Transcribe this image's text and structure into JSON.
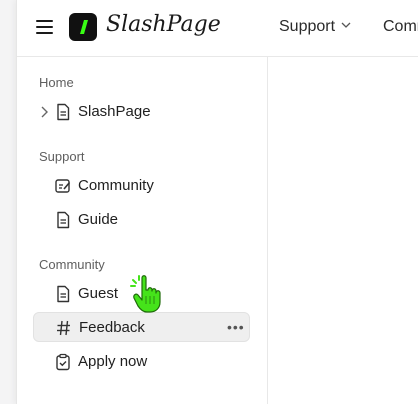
{
  "header": {
    "app_name": "SlashPage",
    "nav": [
      {
        "label": "Support"
      },
      {
        "label": "Community"
      }
    ]
  },
  "sidebar": {
    "sections": [
      {
        "label": "Home"
      },
      {
        "label": "Support"
      },
      {
        "label": "Community"
      }
    ],
    "items": {
      "slashpage": {
        "label": "SlashPage",
        "icon": "document-icon"
      },
      "community": {
        "label": "Community",
        "icon": "edit-note-icon"
      },
      "guide": {
        "label": "Guide",
        "icon": "document-icon"
      },
      "guest": {
        "label": "Guest",
        "icon": "document-icon"
      },
      "feedback": {
        "label": "Feedback",
        "icon": "hashtag-icon"
      },
      "apply_now": {
        "label": "Apply now",
        "icon": "clipboard-check-icon"
      }
    }
  },
  "colors": {
    "accent_logo": "#39ff14",
    "cursor": "#45e31a",
    "active_bg": "#efefef"
  }
}
